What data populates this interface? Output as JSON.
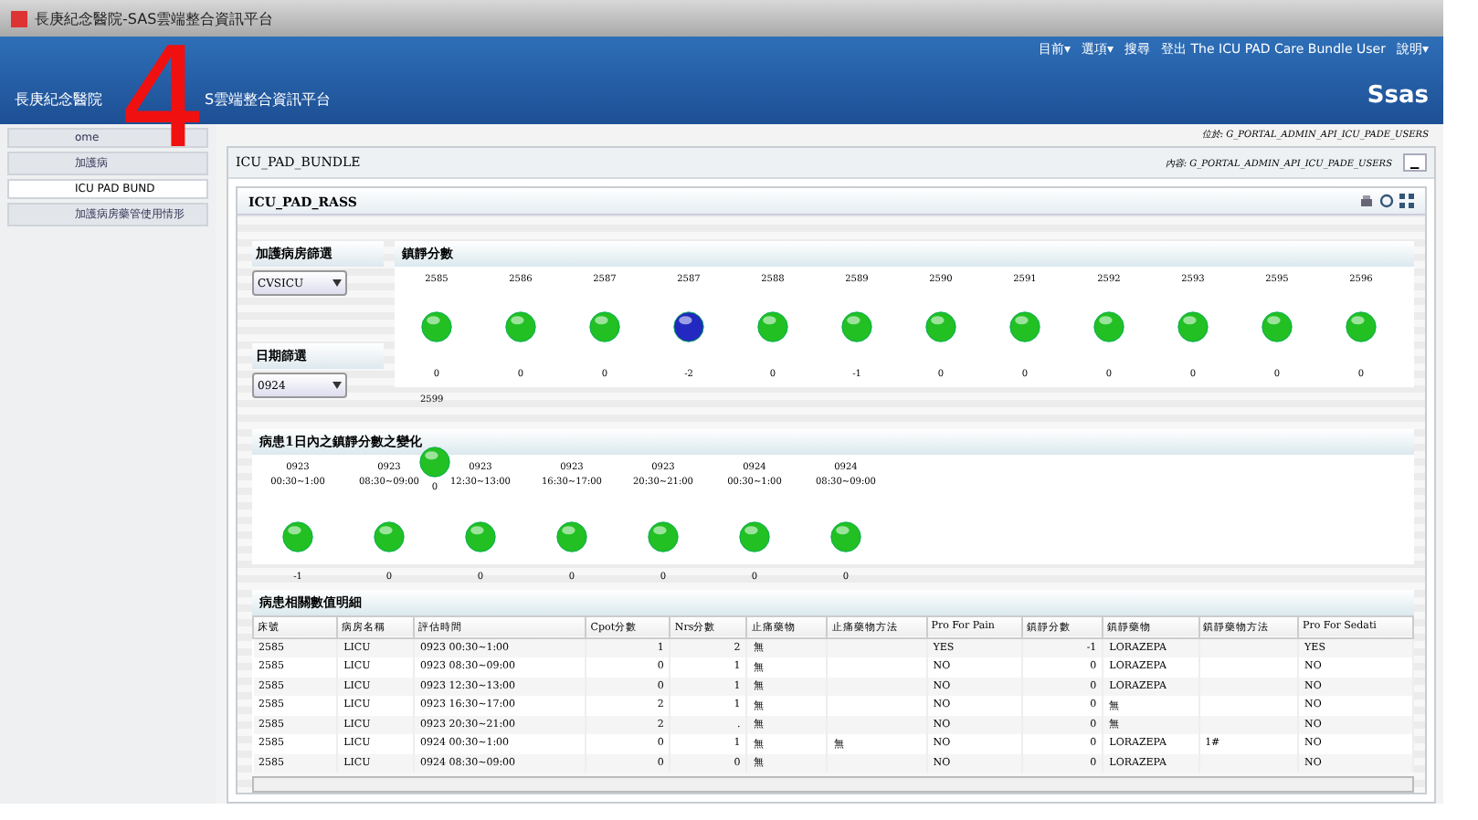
{
  "window": {
    "title": "長庚紀念醫院-SAS雲端整合資訊平台"
  },
  "header": {
    "title_parts": [
      "長庚紀念醫院",
      "S雲端整合資訊平台"
    ],
    "menu": [
      "目前▾",
      "選項▾",
      "搜尋",
      "登出 The ICU PAD Care Bundle User",
      "說明▾"
    ],
    "logo": "Ssas"
  },
  "sidebar": {
    "items": [
      {
        "label": "ome",
        "selected": false
      },
      {
        "label": "加護病",
        "selected": false
      },
      {
        "label": "ICU PAD BUND",
        "selected": true
      },
      {
        "label": "加護病房藥管使用情形",
        "selected": false
      }
    ]
  },
  "breadcrumb": "位於: G_PORTAL_ADMIN_API_ICU_PADE_USERS",
  "portlet": {
    "title": "ICU_PAD_BUNDLE",
    "owner": "內容: G_PORTAL_ADMIN_API_ICU_PADE_USERS",
    "minimize": "▁"
  },
  "panel": {
    "title": "ICU_PAD_RASS"
  },
  "filters": [
    {
      "label": "加護病房篩選",
      "value": "CVSICU"
    },
    {
      "label": "日期篩選",
      "value": "0924"
    }
  ],
  "scores": {
    "title": "鎮靜分數",
    "items": [
      {
        "bed": "2585",
        "value": "0",
        "color": "#22c022"
      },
      {
        "bed": "2586",
        "value": "0",
        "color": "#22c022"
      },
      {
        "bed": "2587",
        "value": "0",
        "color": "#22c022"
      },
      {
        "bed": "2587",
        "value": "-2",
        "color": "#2228c0"
      },
      {
        "bed": "2588",
        "value": "0",
        "color": "#22c022"
      },
      {
        "bed": "2589",
        "value": "-1",
        "color": "#22c022"
      },
      {
        "bed": "2590",
        "value": "0",
        "color": "#22c022"
      },
      {
        "bed": "2591",
        "value": "0",
        "color": "#22c022"
      },
      {
        "bed": "2592",
        "value": "0",
        "color": "#22c022"
      },
      {
        "bed": "2593",
        "value": "0",
        "color": "#22c022"
      },
      {
        "bed": "2595",
        "value": "0",
        "color": "#22c022"
      },
      {
        "bed": "2596",
        "value": "0",
        "color": "#22c022"
      }
    ],
    "overflow_bed": "2599"
  },
  "trend": {
    "title": "病患1日內之鎮靜分數之變化",
    "items": [
      {
        "date": "0923",
        "time": "00:30~1:00",
        "value": "-1",
        "color": "#22c022"
      },
      {
        "date": "0923",
        "time": "08:30~09:00",
        "value": "0",
        "color": "#22c022"
      },
      {
        "date": "0923",
        "time": "12:30~13:00",
        "value": "0",
        "color": "#22c022"
      },
      {
        "date": "0923",
        "time": "16:30~17:00",
        "value": "0",
        "color": "#22c022"
      },
      {
        "date": "0923",
        "time": "20:30~21:00",
        "value": "0",
        "color": "#22c022"
      },
      {
        "date": "0924",
        "time": "00:30~1:00",
        "value": "0",
        "color": "#22c022"
      },
      {
        "date": "0924",
        "time": "08:30~09:00",
        "value": "0",
        "color": "#22c022"
      }
    ],
    "stray_point": {
      "value": "0",
      "color": "#22c022"
    }
  },
  "table": {
    "title": "病患相關數值明細",
    "columns": [
      "床號",
      "病房名稱",
      "評估時間",
      "Cpot分數",
      "Nrs分數",
      "止痛藥物",
      "止痛藥物方法",
      "Pro For Pain",
      "鎮靜分數",
      "鎮靜藥物",
      "鎮靜藥物方法",
      "Pro For Sedati"
    ],
    "rows": [
      [
        "2585",
        "LICU",
        "0923   00:30~1:00",
        "1",
        "2",
        "無",
        "",
        "YES",
        "-1",
        "LORAZEPA",
        "",
        "YES"
      ],
      [
        "2585",
        "LICU",
        "0923   08:30~09:00",
        "0",
        "1",
        "無",
        "",
        "NO",
        "0",
        "LORAZEPA",
        "",
        "NO"
      ],
      [
        "2585",
        "LICU",
        "0923   12:30~13:00",
        "0",
        "1",
        "無",
        "",
        "NO",
        "0",
        "LORAZEPA",
        "",
        "NO"
      ],
      [
        "2585",
        "LICU",
        "0923   16:30~17:00",
        "2",
        "1",
        "無",
        "",
        "NO",
        "0",
        "無",
        "",
        "NO"
      ],
      [
        "2585",
        "LICU",
        "0923   20:30~21:00",
        "2",
        ".",
        "無",
        "",
        "NO",
        "0",
        "無",
        "",
        "NO"
      ],
      [
        "2585",
        "LICU",
        "0924   00:30~1:00",
        "0",
        "1",
        "無",
        "無",
        "NO",
        "0",
        "LORAZEPA",
        "1#",
        "NO"
      ],
      [
        "2585",
        "LICU",
        "0924   08:30~09:00",
        "0",
        "0",
        "無",
        "",
        "NO",
        "0",
        "LORAZEPA",
        "",
        "NO"
      ]
    ]
  },
  "annotation": "4"
}
